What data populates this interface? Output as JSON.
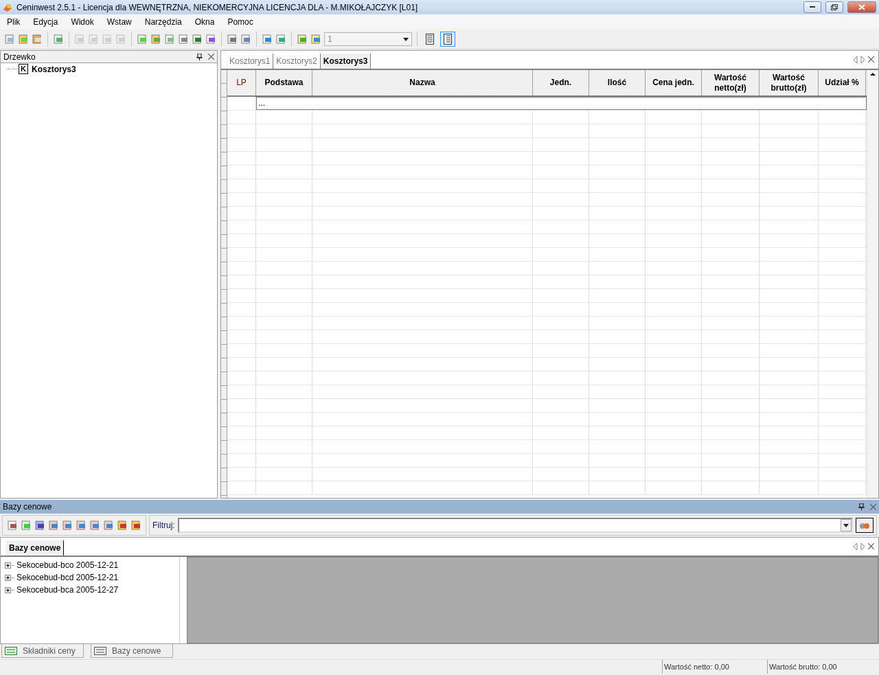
{
  "window": {
    "title": "Ceninwest 2.5.1 - Licencja dla WEWNĘTRZNA, NIEKOMERCYJNA LICENCJA DLA - M.MIKOŁAJCZYK [L01]"
  },
  "menu": [
    "Plik",
    "Edycja",
    "Widok",
    "Wstaw",
    "Narzędzia",
    "Okna",
    "Pomoc"
  ],
  "toolbar": {
    "combo_value": "1",
    "view_buttons": [
      {
        "selected": false
      },
      {
        "selected": true
      }
    ]
  },
  "tree_panel": {
    "title": "Drzewko",
    "items": [
      {
        "badge": "K",
        "label": "Kosztorys3"
      }
    ]
  },
  "doc_tabs": [
    {
      "label": "Kosztorys1",
      "selected": false
    },
    {
      "label": "Kosztorys2",
      "selected": false
    },
    {
      "label": "Kosztorys3",
      "selected": true
    }
  ],
  "table": {
    "columns": [
      "LP",
      "Podstawa",
      "Nazwa",
      "Jedn.",
      "Ilość",
      "Cena jedn.",
      "Wartość netto(zł)",
      "Wartość brutto(zł)",
      "Udział %"
    ],
    "new_row": "..."
  },
  "price_panel": {
    "title": "Bazy cenowe",
    "filter_label": "Filtruj:",
    "tab": "Bazy cenowe",
    "items": [
      {
        "label": "Sekocebud-bco 2005-12-21",
        "expanded": false
      },
      {
        "label": "Sekocebud-bcd 2005-12-21",
        "expanded": false
      },
      {
        "label": "Sekocebud-bca 2005-12-27",
        "expanded": false
      }
    ]
  },
  "bottom_tabs": [
    {
      "label": "Składniki ceny",
      "selected": false
    },
    {
      "label": "Bazy cenowe",
      "selected": false
    }
  ],
  "status_bar": [
    "Wartość netto: 0,00",
    "Wartość brutto: 0,00"
  ]
}
